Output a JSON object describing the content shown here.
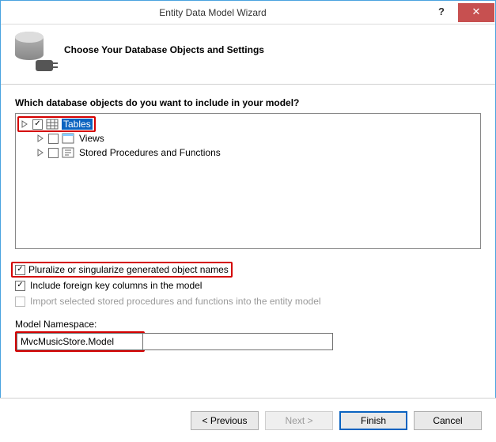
{
  "window": {
    "title": "Entity Data Model Wizard",
    "help": "?",
    "close": "✕"
  },
  "header": {
    "title": "Choose Your Database Objects and Settings"
  },
  "prompt": "Which database objects do you want to include in your model?",
  "tree": {
    "tables": {
      "label": "Tables",
      "checked": true,
      "expandable": true,
      "selected": true
    },
    "views": {
      "label": "Views",
      "checked": false,
      "expandable": true
    },
    "sprocs": {
      "label": "Stored Procedures and Functions",
      "checked": false,
      "expandable": true
    }
  },
  "options": {
    "pluralize": {
      "label": "Pluralize or singularize generated object names",
      "checked": true
    },
    "fk": {
      "label": "Include foreign key columns in the model",
      "checked": true
    },
    "importSprocs": {
      "label": "Import selected stored procedures and functions into the entity model",
      "checked": false,
      "disabled": true
    }
  },
  "namespace": {
    "label": "Model Namespace:",
    "value": "MvcMusicStore.Model"
  },
  "buttons": {
    "previous": "< Previous",
    "next": "Next >",
    "finish": "Finish",
    "cancel": "Cancel"
  }
}
